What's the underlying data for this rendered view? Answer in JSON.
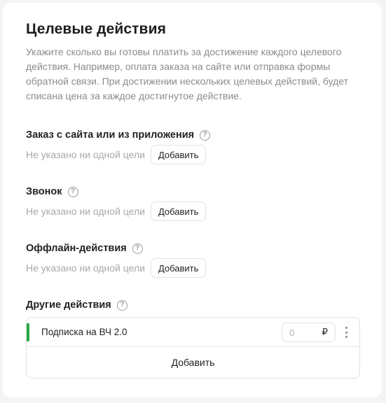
{
  "header": {
    "title": "Целевые действия",
    "description": "Укажите сколько вы готовы платить за достижение каждого целевого действия. Например, оплата заказа на сайте или отправка формы обратной связи. При достижении нескольких целевых действий, будет списана цена за каждое достигнутое действие."
  },
  "sections": [
    {
      "label": "Заказ с сайта или из приложения",
      "help": "?",
      "empty_text": "Не указано ни одной цели",
      "add_label": "Добавить"
    },
    {
      "label": "Звонок",
      "help": "?",
      "empty_text": "Не указано ни одной цели",
      "add_label": "Добавить"
    },
    {
      "label": "Оффлайн-действия",
      "help": "?",
      "empty_text": "Не указано ни одной цели",
      "add_label": "Добавить"
    }
  ],
  "other": {
    "label": "Другие действия",
    "help": "?",
    "goals": [
      {
        "name": "Подписка на ВЧ 2.0",
        "price_value": "0",
        "currency": "₽",
        "active_color": "#2aa845"
      }
    ],
    "add_label": "Добавить"
  }
}
